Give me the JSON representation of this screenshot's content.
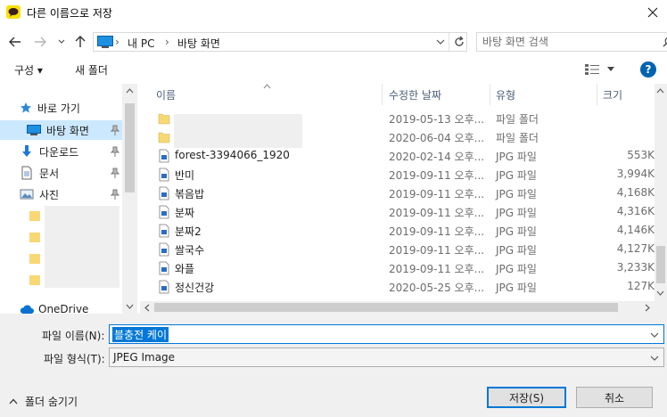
{
  "window": {
    "title": "다른 이름으로 저장",
    "close_label": "✕"
  },
  "address": {
    "crumbs": [
      "내 PC",
      "바탕 화면"
    ],
    "search_placeholder": "바탕 화면 검색"
  },
  "toolbar": {
    "organize_label": "구성 ▾",
    "new_folder_label": "새 폴더",
    "help_label": "?"
  },
  "nav": {
    "quick_access": "바로 가기",
    "items": [
      {
        "label": "바탕 화면",
        "icon": "desktop-icon",
        "pinned": true
      },
      {
        "label": "다운로드",
        "icon": "download-arrow-icon",
        "pinned": true
      },
      {
        "label": "문서",
        "icon": "document-icon",
        "pinned": true
      },
      {
        "label": "사진",
        "icon": "pictures-icon",
        "pinned": true
      }
    ],
    "onedrive": "OneDrive"
  },
  "columns": {
    "name": "이름",
    "modified": "수정한 날짜",
    "type": "유형",
    "size": "크기"
  },
  "files": [
    {
      "name": "",
      "date": "2019-05-13 오후...",
      "type": "파일 폴더",
      "size": "",
      "kind": "folder"
    },
    {
      "name": "",
      "date": "2020-06-04 오후...",
      "type": "파일 폴더",
      "size": "",
      "kind": "folder"
    },
    {
      "name": "forest-3394066_1920",
      "date": "2020-02-14 오후...",
      "type": "JPG 파일",
      "size": "553K",
      "kind": "image"
    },
    {
      "name": "반미",
      "date": "2019-09-11 오후...",
      "type": "JPG 파일",
      "size": "3,994K",
      "kind": "image"
    },
    {
      "name": "볶음밥",
      "date": "2019-09-11 오후...",
      "type": "JPG 파일",
      "size": "4,168K",
      "kind": "image"
    },
    {
      "name": "분짜",
      "date": "2019-09-11 오후...",
      "type": "JPG 파일",
      "size": "4,316K",
      "kind": "image"
    },
    {
      "name": "분짜2",
      "date": "2019-09-11 오후...",
      "type": "JPG 파일",
      "size": "4,146K",
      "kind": "image"
    },
    {
      "name": "쌀국수",
      "date": "2019-09-11 오후...",
      "type": "JPG 파일",
      "size": "4,127K",
      "kind": "image"
    },
    {
      "name": "와플",
      "date": "2019-09-11 오후...",
      "type": "JPG 파일",
      "size": "3,233K",
      "kind": "image"
    },
    {
      "name": "정신건강",
      "date": "2020-05-25 오후...",
      "type": "JPG 파일",
      "size": "127K",
      "kind": "image"
    }
  ],
  "form": {
    "filename_label": "파일 이름(N):",
    "filename_value": "블충전 케이",
    "filetype_label": "파일 형식(T):",
    "filetype_value": "JPEG Image"
  },
  "footer": {
    "hide_folders": "폴더 숨기기",
    "save_label": "저장(S)",
    "cancel_label": "취소"
  },
  "colors": {
    "accent": "#0078d7",
    "selected_bg": "#cce8ff",
    "folder": "#f8d775"
  }
}
